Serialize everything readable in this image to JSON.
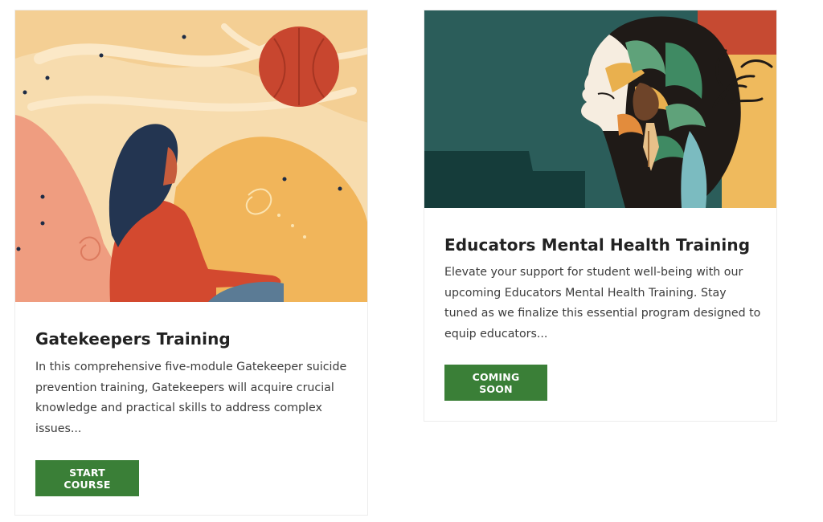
{
  "cards": [
    {
      "title": "Gatekeepers Training",
      "description": "In this comprehensive five-module Gatekeeper suicide prevention training, Gatekeepers will acquire crucial knowledge and practical skills to address complex issues...",
      "button_label": "START COURSE"
    },
    {
      "title": "Educators Mental Health Training",
      "description": "Elevate your support for student well-being with our upcoming Educators Mental Health Training. Stay tuned as we finalize this essential program designed to equip educators...",
      "button_label": "COMING SOON"
    }
  ],
  "colors": {
    "button_green": "#3a7f37",
    "title_text": "#222222",
    "body_text": "#3c3c3c"
  }
}
